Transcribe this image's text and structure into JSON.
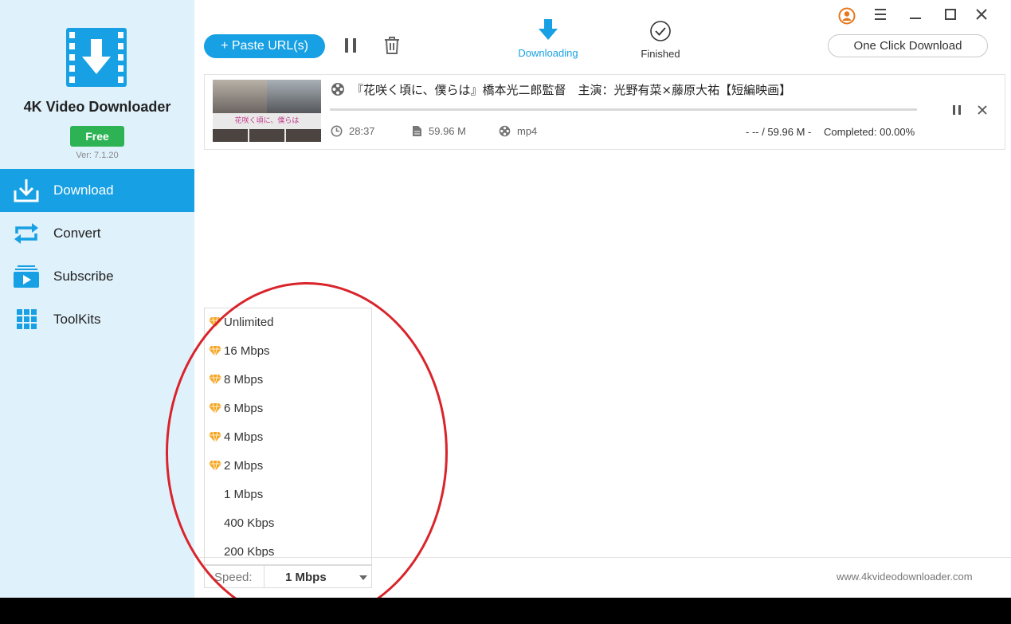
{
  "sidebar": {
    "app_name": "4K Video Downloader",
    "badge": "Free",
    "version": "Ver: 7.1.20",
    "items": [
      {
        "label": "Download",
        "icon": "download-icon",
        "active": true
      },
      {
        "label": "Convert",
        "icon": "convert-icon",
        "active": false
      },
      {
        "label": "Subscribe",
        "icon": "subscribe-icon",
        "active": false
      },
      {
        "label": "ToolKits",
        "icon": "grid-icon",
        "active": false
      }
    ]
  },
  "header": {
    "paste_label": "+ Paste URL(s)",
    "tabs": [
      {
        "label": "Downloading",
        "icon": "download-arrow-icon",
        "active": true
      },
      {
        "label": "Finished",
        "icon": "check-circle-icon",
        "active": false
      }
    ],
    "one_click_label": "One Click Download"
  },
  "download": {
    "title": "『花咲く頃に、僕らは』橋本光二郎監督　主演：光野有菜×藤原大祐【短編映画】",
    "thumbnail_caption": "花咲く頃に、僕らは",
    "duration": "28:37",
    "size": "59.96 M",
    "format": "mp4",
    "transfer": "- -- / 59.96 M -",
    "completed": "Completed: 00.00%",
    "progress": 0
  },
  "speed_menu": {
    "options": [
      {
        "label": "Unlimited",
        "premium": true
      },
      {
        "label": "16 Mbps",
        "premium": true
      },
      {
        "label": "8 Mbps",
        "premium": true
      },
      {
        "label": "6 Mbps",
        "premium": true
      },
      {
        "label": "4 Mbps",
        "premium": true
      },
      {
        "label": "2 Mbps",
        "premium": true
      },
      {
        "label": "1 Mbps",
        "premium": false
      },
      {
        "label": "400 Kbps",
        "premium": false
      },
      {
        "label": "200 Kbps",
        "premium": false
      }
    ]
  },
  "footer": {
    "speed_label": "Speed:",
    "speed_value": "1 Mbps",
    "site": "www.4kvideodownloader.com"
  },
  "colors": {
    "accent": "#17a0e3",
    "sidebar_bg": "#dff1fb",
    "badge": "#2db354",
    "gem": "#f5a623",
    "annotation": "#d9242b"
  }
}
